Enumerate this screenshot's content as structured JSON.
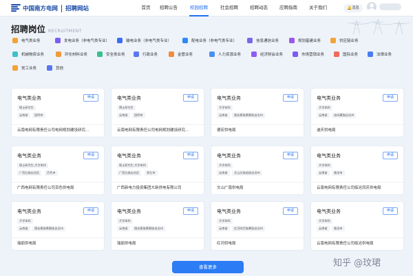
{
  "header": {
    "logo_text": "中国南方电网",
    "logo_subtitle": "招聘网站",
    "nav": [
      {
        "label": "首页"
      },
      {
        "label": "招聘公告"
      },
      {
        "label": "校园招聘"
      },
      {
        "label": "社会招聘"
      },
      {
        "label": "招聘动态"
      },
      {
        "label": "应聘指南"
      },
      {
        "label": "关于我们"
      }
    ],
    "active_nav": "校园招聘",
    "message_label": "消息"
  },
  "section": {
    "title": "招聘岗位",
    "subtitle": "RECRUITMENT"
  },
  "categories": [
    {
      "label": "电气类业务",
      "color": "#f2a33a"
    },
    {
      "label": "发电业务（非电气类专业）",
      "color": "#7c5cf2"
    },
    {
      "label": "输电业务（非电气类专业）",
      "color": "#3b6ff2"
    },
    {
      "label": "配电业务（非电气类专业）",
      "color": "#2f8af5"
    },
    {
      "label": "信息通信业务",
      "color": "#7b66e8"
    },
    {
      "label": "规划基建业务",
      "color": "#9b59e8"
    },
    {
      "label": "供应链业务",
      "color": "#f2a33a"
    },
    {
      "label": "机械物资业务",
      "color": "#3ec1c8"
    },
    {
      "label": "环化材料业务",
      "color": "#f29b3a"
    },
    {
      "label": "安全类业务",
      "color": "#39c08a"
    },
    {
      "label": "行政业务",
      "color": "#5b76f0"
    },
    {
      "label": "金管业务",
      "color": "#f28a3a"
    },
    {
      "label": "人力资源业务",
      "color": "#4c8ef5"
    },
    {
      "label": "经济财会业务",
      "color": "#8e5cf2"
    },
    {
      "label": "市场营销业务",
      "color": "#7c5cf2"
    },
    {
      "label": "国际业务",
      "color": "#f26a5c"
    },
    {
      "label": "法律业务",
      "color": "#4c7cf2"
    },
    {
      "label": "党工业务",
      "color": "#f2a33a"
    },
    {
      "label": "其他",
      "color": "#5b76f0"
    }
  ],
  "apply_label": "申请",
  "jobs": [
    {
      "title": "电气类业务",
      "degree": "硕士研究生",
      "location": "云南省",
      "area": "昆明市",
      "company": "云南电网有限责任公司电网规划建设研究..."
    },
    {
      "title": "电气类业务",
      "degree": "博士研究生",
      "location": "云南省",
      "area": "昆明市",
      "company": "云南电网有限责任公司电网规划建设研究..."
    },
    {
      "title": "电气类业务",
      "degree": "大学本科",
      "location": "云南省",
      "area": "德宏傣族景颇族自治州",
      "company": "德宏供电局"
    },
    {
      "title": "电气类业务",
      "degree": "大学本科",
      "location": "云南省",
      "area": "迪庆藏族自治州",
      "company": "迪庆供电局"
    },
    {
      "title": "电气类业务",
      "degree": "硕士研究生,大学本科",
      "location": "广西壮族自治区",
      "area": "百色市",
      "company": "广西电网有限责任公司百色供电局"
    },
    {
      "title": "电气类业务",
      "degree": "硕士研究生,大学本科",
      "location": "广西壮族自治区",
      "area": "崇左市",
      "company": "广西新电力投资集团大新供电有限公司"
    },
    {
      "title": "电气类业务",
      "degree": "大学本科",
      "location": "云南省",
      "area": "文山壮族苗族自治州",
      "company": "文山广南供电局"
    },
    {
      "title": "电气类业务",
      "degree": "大学本科",
      "location": "云南省",
      "area": "临沧市",
      "company": "云南电网有限责任公司临沧凤庆供电局"
    },
    {
      "title": "电气类业务",
      "degree": "大学本科",
      "location": "云南省",
      "area": "德宏傣族景颇族自治州",
      "company": "瑞丽供电局"
    },
    {
      "title": "电气类业务",
      "degree": "大学本科",
      "location": "云南省",
      "area": "德宏傣族景颇族自治州",
      "company": "瑞丽供电局"
    },
    {
      "title": "电气类业务",
      "degree": "大学本科",
      "location": "云南省",
      "area": "红河哈尼族彝族自治州",
      "company": "红河供电局"
    },
    {
      "title": "电气类业务",
      "degree": "大学本科",
      "location": "云南省",
      "area": "临沧市",
      "company": "云南电网有限责任公司临沧供电局"
    }
  ],
  "more_button": "查看更多",
  "watermark": "知乎 @玟珺",
  "colors": {
    "accent": "#1f6ff2",
    "brand": "#1a4ca8"
  }
}
